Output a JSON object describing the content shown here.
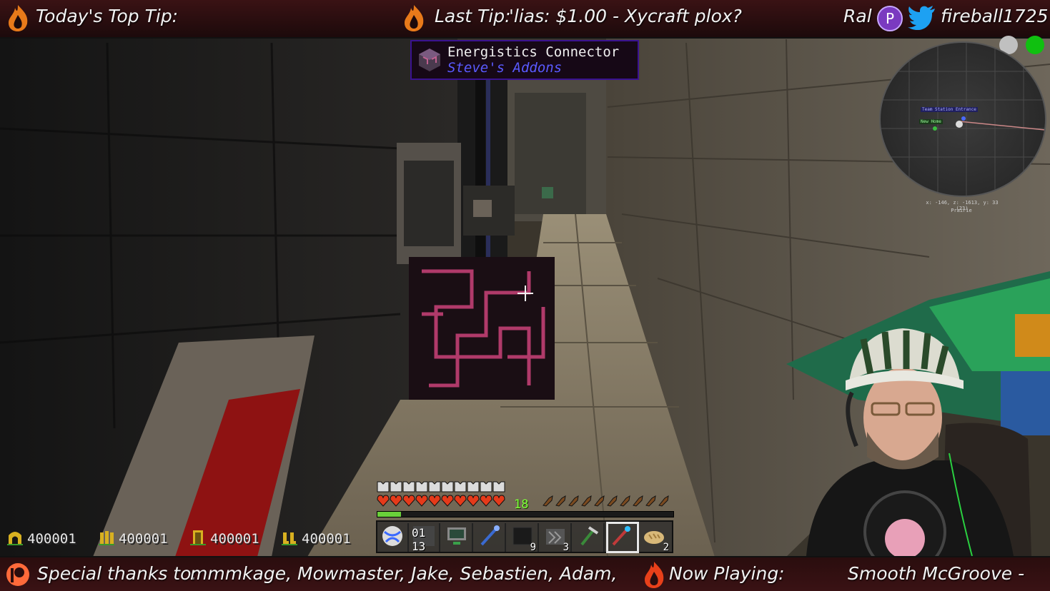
{
  "top_bar": {
    "top_tip_label": "Today's Top Tip:",
    "last_tip_label": "Last Tip:",
    "last_tip_value": "'lias:  $1.00  -  Xycraft  plox?",
    "social_name_partial": "Ral",
    "twitter_handle": "fireball1725"
  },
  "tooltip": {
    "item_name": "Energistics Connector",
    "mod_name": "Steve's Addons"
  },
  "minimap": {
    "waypoint_1": "Team Station Entrance",
    "waypoint_2": "New Home",
    "coords": "x: -146, z: -1613, y: 33 (23)",
    "biome": "Prairie",
    "status_colors": [
      "#c0c0c0",
      "#10c010"
    ]
  },
  "hud": {
    "xp_level": "18",
    "xp_progress": 0.08,
    "health_hearts": 10,
    "armor_points": 10,
    "hunger": 10,
    "stats": [
      {
        "icon": "gold-arch-icon",
        "value": "400001"
      },
      {
        "icon": "gold-pillars-icon",
        "value": "400001"
      },
      {
        "icon": "gold-door-icon",
        "value": "400001"
      },
      {
        "icon": "gold-boots-icon",
        "value": "400001"
      }
    ],
    "hotbar": [
      {
        "icon": "globe-icon",
        "count": ""
      },
      {
        "icon": "number-block-icon",
        "count": "01​13"
      },
      {
        "icon": "monitor-icon",
        "count": ""
      },
      {
        "icon": "wrench-icon",
        "count": ""
      },
      {
        "icon": "dark-block-icon",
        "count": "9"
      },
      {
        "icon": "cable-icon",
        "count": "3"
      },
      {
        "icon": "pickaxe-icon",
        "count": ""
      },
      {
        "icon": "staff-icon",
        "count": ""
      },
      {
        "icon": "bread-icon",
        "count": "2"
      }
    ],
    "selected_slot": 7
  },
  "bottom_bar": {
    "thanks_label": "Special thanks to:",
    "thanks_names": "mmmkage,  Mowmaster,  Jake,  Sebastien,  Adam,",
    "now_playing_label": "Now Playing:",
    "now_playing_value": "Smooth  McGroove  -"
  },
  "colors": {
    "bar_bg": "#2a0d0e",
    "tooltip_border": "#3a1290",
    "mod_name": "#5a5aff",
    "xp": "#6ad03a",
    "heart": "#e53a1a",
    "hunger": "#7a4a20"
  }
}
